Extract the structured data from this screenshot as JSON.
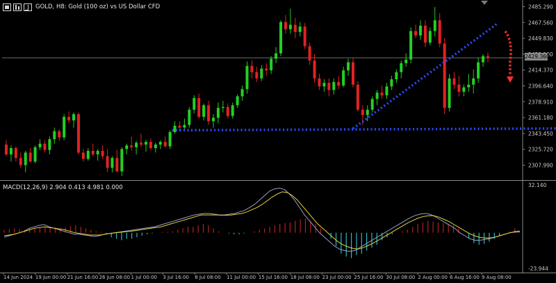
{
  "window": {
    "title": "GOLD, H8:  Gold (100 oz) vs US Dollar CFD",
    "current_price": "2429.360",
    "macd_label": "MACD(12,26,9) 2.904 0.413 4.981 0.000"
  },
  "colors": {
    "background": "#000000",
    "bull": "#22d022",
    "bear": "#e22222",
    "macd_hist_pos": "#b22222",
    "macd_hist_neg": "#2bb8c6",
    "macd_line": "#9aa0c8",
    "signal_line": "#e6d23a",
    "trendline": "#2a4bff",
    "projection_arrow": "#ff3030",
    "axis_text": "#c8c8c8"
  },
  "icons": [
    "window-icon",
    "bar-chart-icon",
    "line-chart-icon"
  ],
  "chart_data": [
    {
      "type": "candlestick",
      "symbol": "GOLD",
      "timeframe": "H8",
      "title": "Gold (100 oz) vs US Dollar CFD",
      "y_ticks": [
        2485.29,
        2467.56,
        2449.83,
        2432.1,
        2414.37,
        2396.64,
        2378.91,
        2361.18,
        2343.45,
        2325.72,
        2307.99
      ],
      "y_tick_labels": [
        "2485.290",
        "2467.560",
        "2449.830",
        "2432.100",
        "2414.370",
        "2396.640",
        "2378.910",
        "2361.180",
        "2343.450",
        "2325.720",
        "2307.990"
      ],
      "ylim": [
        2300,
        2490
      ],
      "x_tick_labels": [
        "14 Jun 2024",
        "19 Jun 00:00",
        "21 Jun 16:00",
        "26 Jun 08:00",
        "1 Jul 00:00",
        "3 Jul 16:00",
        "8 Jul 08:00",
        "11 Jul 00:00",
        "15 Jul 16:00",
        "18 Jul 08:00",
        "23 Jul 00:00",
        "25 Jul 16:00",
        "30 Jul 08:00",
        "2 Aug 00:00",
        "6 Aug 16:00",
        "9 Aug 08:00"
      ],
      "candles": [
        [
          2331,
          2336,
          2318,
          2320
        ],
        [
          2320,
          2330,
          2312,
          2327
        ],
        [
          2327,
          2329,
          2312,
          2316
        ],
        [
          2316,
          2322,
          2305,
          2308
        ],
        [
          2308,
          2324,
          2300,
          2322
        ],
        [
          2322,
          2327,
          2311,
          2312
        ],
        [
          2312,
          2330,
          2310,
          2328
        ],
        [
          2328,
          2337,
          2325,
          2332
        ],
        [
          2332,
          2336,
          2322,
          2325
        ],
        [
          2325,
          2340,
          2320,
          2337
        ],
        [
          2337,
          2350,
          2332,
          2346
        ],
        [
          2346,
          2348,
          2335,
          2339
        ],
        [
          2339,
          2365,
          2336,
          2362
        ],
        [
          2362,
          2368,
          2355,
          2358
        ],
        [
          2358,
          2367,
          2350,
          2365
        ],
        [
          2365,
          2367,
          2320,
          2322
        ],
        [
          2322,
          2326,
          2312,
          2315
        ],
        [
          2315,
          2327,
          2313,
          2324
        ],
        [
          2324,
          2332,
          2318,
          2320
        ],
        [
          2320,
          2326,
          2313,
          2324
        ],
        [
          2324,
          2330,
          2315,
          2318
        ],
        [
          2318,
          2326,
          2300,
          2305
        ],
        [
          2305,
          2318,
          2300,
          2316
        ],
        [
          2316,
          2325,
          2300,
          2301
        ],
        [
          2301,
          2328,
          2296,
          2326
        ],
        [
          2326,
          2332,
          2320,
          2330
        ],
        [
          2330,
          2340,
          2324,
          2328
        ],
        [
          2328,
          2335,
          2320,
          2333
        ],
        [
          2333,
          2343,
          2328,
          2331
        ],
        [
          2331,
          2336,
          2323,
          2334
        ],
        [
          2334,
          2338,
          2325,
          2327
        ],
        [
          2327,
          2333,
          2322,
          2331
        ],
        [
          2331,
          2336,
          2326,
          2334
        ],
        [
          2334,
          2340,
          2328,
          2329
        ],
        [
          2329,
          2347,
          2326,
          2345
        ],
        [
          2345,
          2357,
          2343,
          2352
        ],
        [
          2352,
          2357,
          2346,
          2350
        ],
        [
          2350,
          2360,
          2347,
          2353
        ],
        [
          2353,
          2373,
          2350,
          2370
        ],
        [
          2370,
          2386,
          2366,
          2383
        ],
        [
          2383,
          2388,
          2360,
          2362
        ],
        [
          2362,
          2377,
          2358,
          2375
        ],
        [
          2375,
          2380,
          2353,
          2357
        ],
        [
          2357,
          2365,
          2350,
          2361
        ],
        [
          2361,
          2378,
          2355,
          2372
        ],
        [
          2372,
          2380,
          2367,
          2373
        ],
        [
          2373,
          2377,
          2360,
          2363
        ],
        [
          2363,
          2378,
          2360,
          2375
        ],
        [
          2375,
          2387,
          2372,
          2385
        ],
        [
          2385,
          2397,
          2380,
          2393
        ],
        [
          2393,
          2424,
          2388,
          2419
        ],
        [
          2419,
          2425,
          2405,
          2412
        ],
        [
          2412,
          2418,
          2401,
          2405
        ],
        [
          2405,
          2420,
          2402,
          2416
        ],
        [
          2416,
          2422,
          2408,
          2414
        ],
        [
          2414,
          2430,
          2410,
          2427
        ],
        [
          2427,
          2440,
          2422,
          2433
        ],
        [
          2433,
          2470,
          2430,
          2468
        ],
        [
          2468,
          2476,
          2455,
          2460
        ],
        [
          2460,
          2483,
          2455,
          2465
        ],
        [
          2465,
          2473,
          2450,
          2457
        ],
        [
          2457,
          2468,
          2452,
          2463
        ],
        [
          2463,
          2467,
          2438,
          2441
        ],
        [
          2441,
          2445,
          2420,
          2425
        ],
        [
          2425,
          2432,
          2400,
          2405
        ],
        [
          2405,
          2410,
          2392,
          2396
        ],
        [
          2396,
          2404,
          2390,
          2400
        ],
        [
          2400,
          2405,
          2385,
          2392
        ],
        [
          2392,
          2405,
          2387,
          2401
        ],
        [
          2401,
          2408,
          2393,
          2397
        ],
        [
          2397,
          2418,
          2395,
          2414
        ],
        [
          2414,
          2427,
          2408,
          2423
        ],
        [
          2423,
          2428,
          2395,
          2398
        ],
        [
          2398,
          2402,
          2368,
          2370
        ],
        [
          2370,
          2375,
          2353,
          2364
        ],
        [
          2364,
          2375,
          2357,
          2370
        ],
        [
          2370,
          2385,
          2367,
          2382
        ],
        [
          2382,
          2392,
          2375,
          2389
        ],
        [
          2389,
          2397,
          2382,
          2386
        ],
        [
          2386,
          2400,
          2382,
          2396
        ],
        [
          2396,
          2408,
          2392,
          2404
        ],
        [
          2404,
          2415,
          2400,
          2412
        ],
        [
          2412,
          2425,
          2405,
          2422
        ],
        [
          2422,
          2433,
          2418,
          2426
        ],
        [
          2426,
          2462,
          2422,
          2458
        ],
        [
          2458,
          2465,
          2450,
          2453
        ],
        [
          2453,
          2470,
          2448,
          2464
        ],
        [
          2464,
          2470,
          2440,
          2445
        ],
        [
          2445,
          2462,
          2442,
          2458
        ],
        [
          2458,
          2485,
          2452,
          2470
        ],
        [
          2470,
          2478,
          2440,
          2444
        ],
        [
          2444,
          2450,
          2365,
          2372
        ],
        [
          2372,
          2410,
          2368,
          2405
        ],
        [
          2405,
          2412,
          2393,
          2398
        ],
        [
          2398,
          2408,
          2385,
          2390
        ],
        [
          2390,
          2398,
          2385,
          2395
        ],
        [
          2395,
          2410,
          2390,
          2398
        ],
        [
          2398,
          2415,
          2388,
          2405
        ],
        [
          2405,
          2428,
          2400,
          2423
        ],
        [
          2423,
          2432,
          2418,
          2430
        ],
        [
          2430,
          2434,
          2423,
          2428
        ]
      ],
      "support_line": [
        2347,
        2349
      ],
      "rising_trendline": [
        2349,
        2467
      ],
      "projection_arrow": "down"
    },
    {
      "type": "macd",
      "label": "MACD(12,26,9) 2.904 0.413 4.981 0.000",
      "y_tick_labels": [
        "32.140",
        "-23.944"
      ],
      "ylim": [
        -23.944,
        32.14
      ],
      "histogram": [
        2,
        2.5,
        3,
        2.5,
        2,
        3,
        3,
        3.5,
        4,
        4,
        3.5,
        3,
        3.5,
        4.5,
        5,
        4,
        3,
        2,
        1,
        0.5,
        -1,
        -3,
        -4,
        -5,
        -4,
        -4,
        -3,
        -2,
        -1,
        -0.5,
        0,
        0.5,
        0.5,
        1,
        2,
        3,
        4,
        4,
        5,
        6,
        5,
        3,
        1,
        0,
        -0.5,
        -1,
        -1,
        -0.5,
        0,
        1,
        2,
        3,
        4,
        5,
        6,
        6.5,
        7,
        8,
        9,
        9.5,
        8,
        6,
        3,
        0,
        -4,
        -9,
        -14,
        -16,
        -17,
        -15,
        -14,
        -12,
        -10,
        -8,
        -5,
        -3,
        -1,
        0,
        1,
        2,
        4,
        6,
        7,
        8,
        7.5,
        7,
        6.5,
        6,
        5,
        3,
        0,
        -4,
        -7,
        -8,
        -7.5,
        -6,
        -4,
        -2,
        0,
        1,
        3
      ],
      "macd_line": [
        -3,
        -2,
        -1,
        0,
        1,
        3,
        4,
        5,
        5.5,
        4,
        3,
        2,
        1,
        0,
        -1,
        -1,
        -1.5,
        -2,
        -2.5,
        -2,
        -1,
        -0.5,
        0,
        0.5,
        1,
        1.5,
        2,
        2.5,
        3,
        3.5,
        4,
        5,
        6,
        7,
        8,
        9,
        10,
        11,
        12,
        12.5,
        13,
        13,
        12.5,
        12,
        12,
        12.5,
        13,
        14,
        15,
        17,
        19,
        22,
        25,
        28,
        29.5,
        30,
        29,
        26,
        22,
        17,
        12,
        8,
        4,
        0,
        -3,
        -6,
        -9,
        -11,
        -12,
        -12.5,
        -12,
        -10,
        -8,
        -6,
        -4,
        -2,
        0,
        2,
        4,
        6,
        8,
        10,
        11.5,
        12.5,
        13,
        12.5,
        11,
        9,
        7,
        5,
        3,
        0,
        -2,
        -4,
        -5,
        -5,
        -4.5,
        -4,
        -3,
        -2,
        -1,
        0,
        0.5,
        0.5
      ],
      "signal_line": [
        -2,
        -1.5,
        -1,
        0,
        1,
        2,
        3,
        3.5,
        4,
        3.5,
        3,
        2.5,
        2,
        1,
        0,
        -0.5,
        -1,
        -1.5,
        -1.5,
        -1.5,
        -1,
        -0.5,
        0,
        0.3,
        0.7,
        1,
        1.5,
        2,
        2.5,
        3,
        3.5,
        4,
        5,
        6,
        7,
        8,
        9,
        10,
        11,
        12,
        12,
        12,
        12,
        11.8,
        11.8,
        12,
        12.5,
        13,
        14,
        15.5,
        17,
        19,
        21.5,
        24,
        26,
        27.5,
        27,
        25,
        22,
        18,
        14,
        10,
        6,
        3,
        0,
        -3,
        -6,
        -8,
        -9.5,
        -10.5,
        -11,
        -10,
        -8.5,
        -7,
        -5,
        -3,
        -1,
        1,
        3,
        5,
        7,
        8.5,
        10,
        11,
        11.5,
        11.5,
        10.5,
        9,
        7.5,
        5.5,
        3.5,
        1.5,
        -0.5,
        -2,
        -3,
        -3.5,
        -3.5,
        -3,
        -2,
        -1,
        0,
        0.8,
        1.2
      ]
    }
  ]
}
